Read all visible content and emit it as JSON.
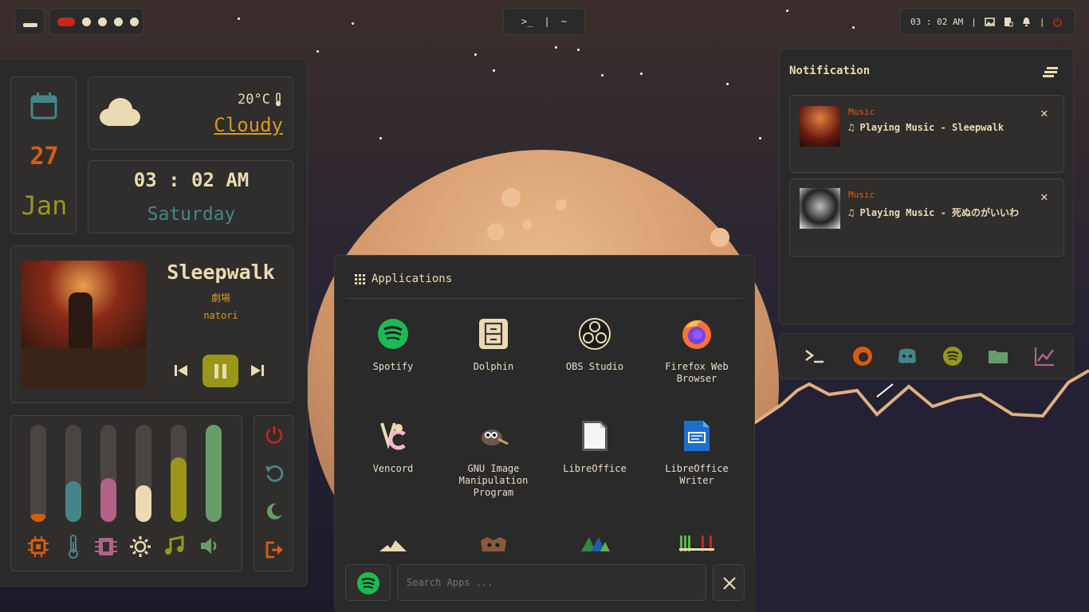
{
  "topbar": {
    "terminal_prompt": ">_",
    "separator": "|",
    "tilde": "~",
    "clock": "03 : 02 AM"
  },
  "date": {
    "day": "27",
    "month": "Jan"
  },
  "weather": {
    "temperature": "20°C",
    "condition": "Cloudy"
  },
  "clock": {
    "time": "03 : 02 AM",
    "weekday": "Saturday"
  },
  "player": {
    "title": "Sleepwalk",
    "album": "劇場",
    "artist": "natori"
  },
  "stats": {
    "items": [
      {
        "name": "cpu",
        "icon": "cpu-icon",
        "level": 0.08,
        "color": "#d35d0e"
      },
      {
        "name": "temperature",
        "icon": "thermometer-icon",
        "level": 0.42,
        "color": "#458588"
      },
      {
        "name": "ram",
        "icon": "memory-icon",
        "level": 0.45,
        "color": "#b16286"
      },
      {
        "name": "brightness",
        "icon": "brightness-icon",
        "level": 0.38,
        "color": "#ebdbb2"
      },
      {
        "name": "music",
        "icon": "music-note-icon",
        "level": 0.66,
        "color": "#98971a"
      },
      {
        "name": "volume",
        "icon": "volume-icon",
        "level": 1.0,
        "color": "#689d6a"
      }
    ]
  },
  "power": [
    "power-icon",
    "restart-icon",
    "sleep-icon",
    "logout-icon"
  ],
  "notifications": {
    "title": "Notification",
    "items": [
      {
        "app": "Music",
        "body": "♫ Playing Music - Sleepwalk"
      },
      {
        "app": "Music",
        "body": "♫ Playing Music - 死ぬのがいいわ"
      }
    ]
  },
  "launcher": {
    "title": "Applications",
    "apps": [
      {
        "label": "Spotify"
      },
      {
        "label": "Dolphin"
      },
      {
        "label": "OBS Studio"
      },
      {
        "label": "Firefox Web Browser"
      },
      {
        "label": "Vencord"
      },
      {
        "label": "GNU Image Manipulation Program"
      },
      {
        "label": "LibreOffice"
      },
      {
        "label": "LibreOffice Writer"
      }
    ],
    "search_placeholder": "Search Apps ..."
  },
  "dock": [
    "terminal-icon",
    "firefox-icon",
    "discord-icon",
    "spotify-icon",
    "folder-icon",
    "monitor-graph-icon"
  ]
}
